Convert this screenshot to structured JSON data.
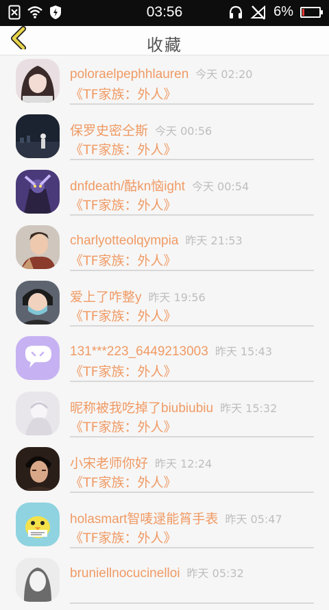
{
  "status_bar": {
    "time": "03:56",
    "battery_percent_text": "6%",
    "battery_level": 0.06,
    "battery_color": "#e53935"
  },
  "header": {
    "title": "收藏",
    "back_icon": "chevron-left-icon",
    "accent_color": "#e8d44a"
  },
  "favorites": [
    {
      "name": "poloraelpephhlauren",
      "time": "今天 02:20",
      "subtitle": "《TF家族：外人》",
      "avatar": "girl-portrait"
    },
    {
      "name": "保罗史密仝斯",
      "time": "今天 00:56",
      "subtitle": "《TF家族：外人》",
      "avatar": "night-city"
    },
    {
      "name": "dnfdeath/酤kn恼ight",
      "time": "今天 00:54",
      "subtitle": "《TF家族：外人》",
      "avatar": "game-character"
    },
    {
      "name": "charlyotteolqympia",
      "time": "昨天 21:53",
      "subtitle": "《TF家族：外人》",
      "avatar": "boy-portrait"
    },
    {
      "name": "爱上了咋整y",
      "time": "昨天 19:56",
      "subtitle": "《TF家族：外人》",
      "avatar": "masked-boy"
    },
    {
      "name": "131***223_6449213003",
      "time": "昨天 15:43",
      "subtitle": "《TF家族：外人》",
      "avatar": "chat-bubble"
    },
    {
      "name": "昵称被我吃掉了biubiubiu",
      "time": "昨天 15:32",
      "subtitle": "《TF家族：外人》",
      "avatar": "white-figure"
    },
    {
      "name": "小宋老师你好",
      "time": "昨天 12:24",
      "subtitle": "《TF家族：外人》",
      "avatar": "dark-boy"
    },
    {
      "name": "holasmart智唛逯能筲手表",
      "time": "昨天 05:47",
      "subtitle": "《TF家族：外人》",
      "avatar": "yellow-bird"
    },
    {
      "name": "bruniellnocucinelloi",
      "time": "昨天 05:32",
      "subtitle": "",
      "avatar": "sketch-girl"
    }
  ]
}
